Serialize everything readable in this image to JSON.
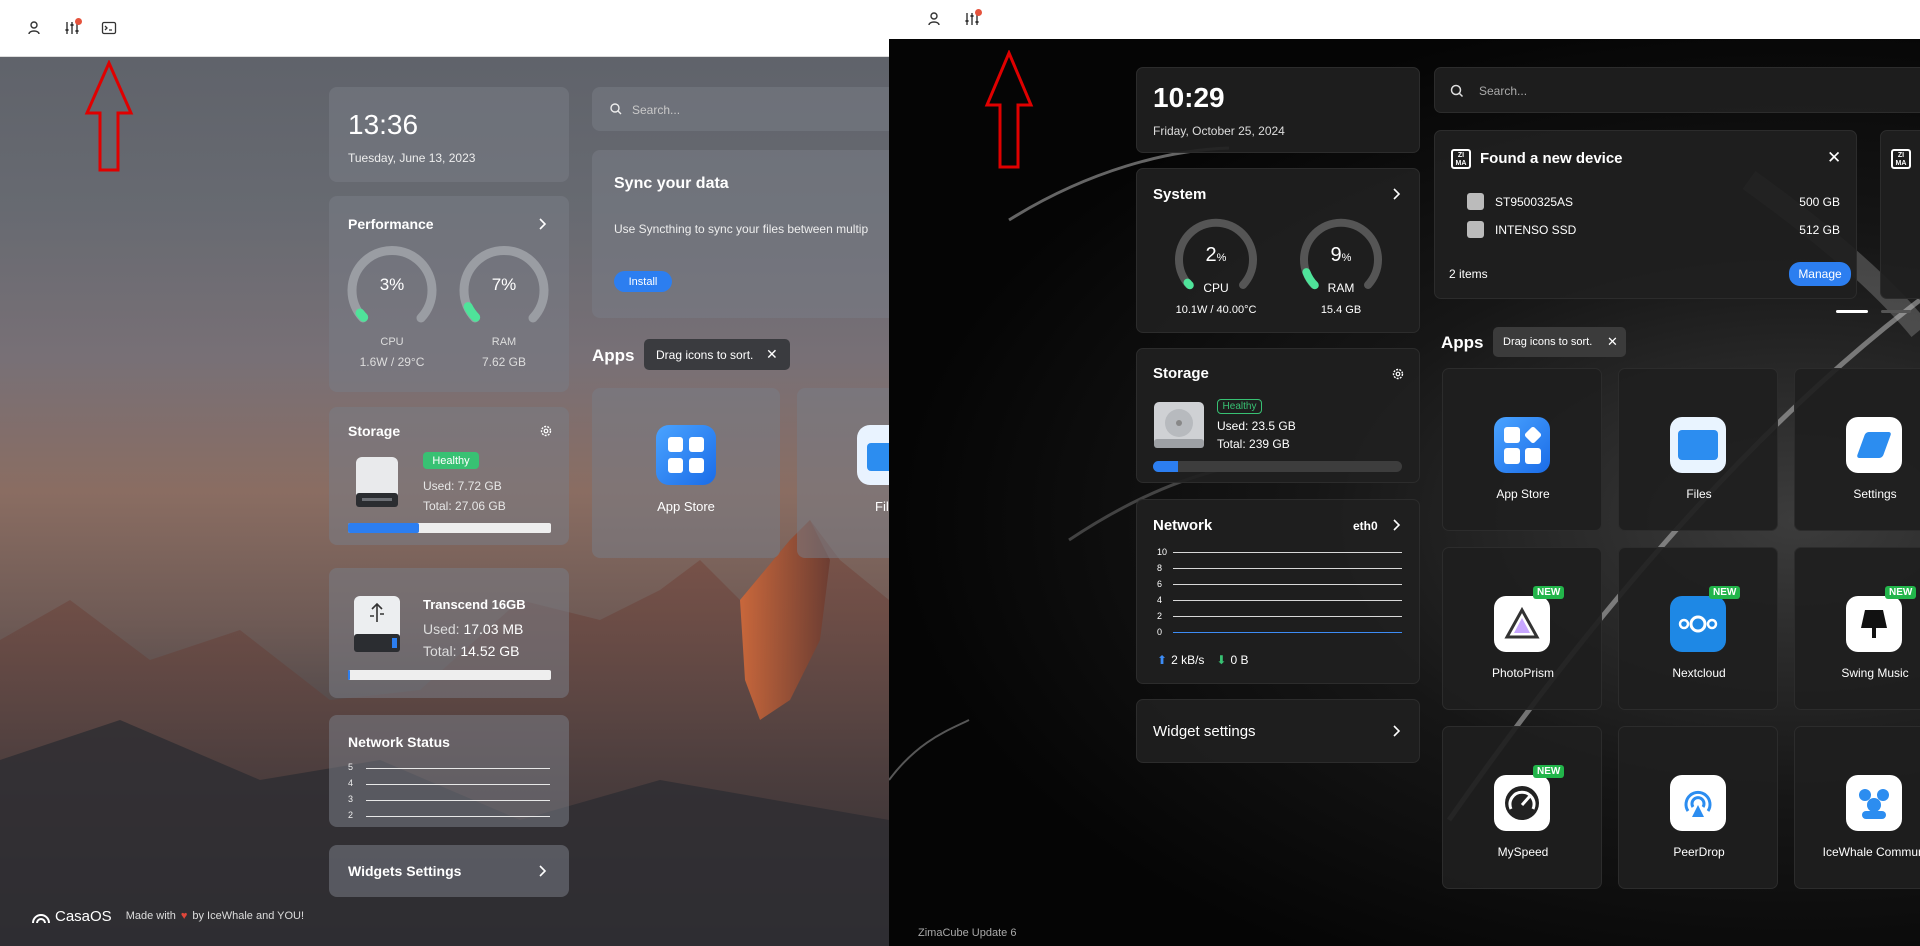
{
  "left": {
    "clock": {
      "time": "13:36",
      "date": "Tuesday, June 13, 2023"
    },
    "search": {
      "placeholder": "Search..."
    },
    "sync": {
      "title": "Sync your data",
      "desc": "Use Syncthing to sync your files between multip",
      "install": "Install"
    },
    "apps": {
      "title": "Apps",
      "tooltip": "Drag icons to sort.",
      "items": [
        {
          "label": "App Store"
        },
        {
          "label": "Fil"
        }
      ]
    },
    "performance": {
      "title": "Performance",
      "cpu": {
        "percent": "3%",
        "label": "CPU",
        "detail": "1.6W / 29°C",
        "value": 3
      },
      "ram": {
        "percent": "7%",
        "label": "RAM",
        "detail": "7.62 GB",
        "value": 7
      }
    },
    "storage": {
      "title": "Storage",
      "status": "Healthy",
      "used": "Used: 7.72 GB",
      "total": "Total: 27.06 GB",
      "fill_percent": 35
    },
    "usb": {
      "name": "Transcend 16GB",
      "used_label": "Used: ",
      "used": "17.03 MB",
      "total_label": "Total: ",
      "total": "14.52 GB",
      "fill_percent": 1
    },
    "network": {
      "title": "Network Status",
      "ticks": [
        "5",
        "4",
        "3",
        "2"
      ]
    },
    "widgets": {
      "title": "Widgets Settings"
    },
    "footer": {
      "brand": "CasaOS",
      "made": "Made with",
      "by": "by IceWhale and YOU!"
    }
  },
  "right": {
    "clock": {
      "time": "10:29",
      "date": "Friday, October 25, 2024"
    },
    "search": {
      "placeholder": "Search..."
    },
    "system": {
      "title": "System",
      "cpu": {
        "value": "2",
        "unit": "%",
        "label": "CPU",
        "detail": "10.1W / 40.00°C",
        "percent": 2
      },
      "ram": {
        "value": "9",
        "unit": "%",
        "label": "RAM",
        "detail": "15.4 GB",
        "percent": 9
      }
    },
    "device": {
      "title": "Found a new device",
      "items": [
        {
          "name": "ST9500325AS",
          "size": "500 GB"
        },
        {
          "name": "INTENSO SSD",
          "size": "512 GB"
        }
      ],
      "count": "2 items",
      "manage": "Manage"
    },
    "storage": {
      "title": "Storage",
      "status": "Healthy",
      "used": "Used: 23.5 GB",
      "total": "Total: 239 GB",
      "fill_percent": 10
    },
    "network": {
      "title": "Network",
      "iface": "eth0",
      "ticks": [
        "10",
        "8",
        "6",
        "4",
        "2",
        "0"
      ],
      "up": "2 kB/s",
      "down": "0 B"
    },
    "widgets": {
      "title": "Widget settings"
    },
    "apps": {
      "title": "Apps",
      "tooltip": "Drag icons to sort.",
      "badge": "NEW",
      "items": [
        {
          "label": "App Store"
        },
        {
          "label": "Files"
        },
        {
          "label": "Settings"
        },
        {
          "label": "PhotoPrism"
        },
        {
          "label": "Nextcloud"
        },
        {
          "label": "Swing Music"
        },
        {
          "label": "MySpeed"
        },
        {
          "label": "PeerDrop"
        },
        {
          "label": "IceWhale Communi"
        }
      ]
    },
    "footer": {
      "label": "ZimaCube Update 6"
    }
  },
  "colors": {
    "accent": "#2c7ef0",
    "healthy": "#38c173",
    "notify": "#e5533d",
    "arrow": "#e00000",
    "gauge_green": "#4fe39a"
  }
}
